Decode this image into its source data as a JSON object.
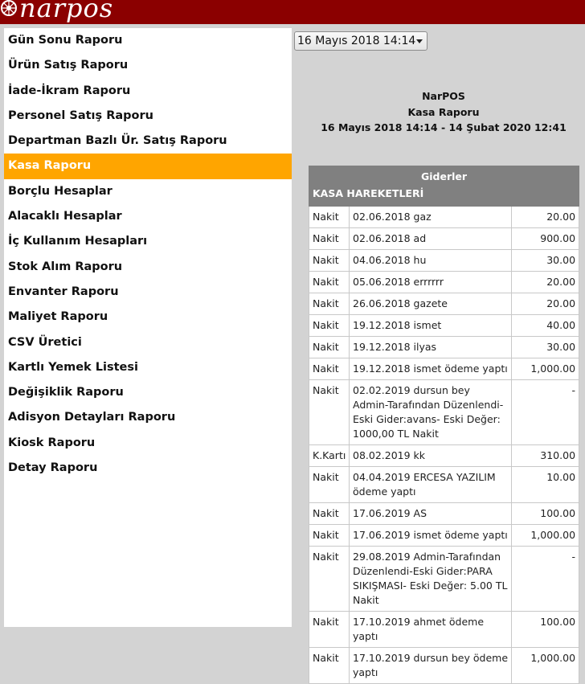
{
  "app": {
    "logo_text": "narpos"
  },
  "sidebar": {
    "items": [
      {
        "label": "Gün Sonu Raporu",
        "active": false
      },
      {
        "label": "Ürün Satış Raporu",
        "active": false
      },
      {
        "label": "İade-İkram Raporu",
        "active": false
      },
      {
        "label": "Personel Satış Raporu",
        "active": false
      },
      {
        "label": "Departman Bazlı Ür. Satış Raporu",
        "active": false
      },
      {
        "label": "Kasa Raporu",
        "active": true
      },
      {
        "label": "Borçlu Hesaplar",
        "active": false
      },
      {
        "label": "Alacaklı Hesaplar",
        "active": false
      },
      {
        "label": "İç Kullanım Hesapları",
        "active": false
      },
      {
        "label": "Stok Alım Raporu",
        "active": false
      },
      {
        "label": "Envanter Raporu",
        "active": false
      },
      {
        "label": "Maliyet Raporu",
        "active": false
      },
      {
        "label": "CSV Üretici",
        "active": false
      },
      {
        "label": "Kartlı Yemek Listesi",
        "active": false
      },
      {
        "label": "Değişiklik Raporu",
        "active": false
      },
      {
        "label": "Adisyon Detayları Raporu",
        "active": false
      },
      {
        "label": "Kiosk Raporu",
        "active": false
      },
      {
        "label": "Detay Raporu",
        "active": false
      }
    ]
  },
  "date_select": {
    "value": "16 Mayıs 2018 14:14"
  },
  "report": {
    "company": "NarPOS",
    "title": "Kasa Raporu",
    "range": "16 Mayıs 2018 14:14 - 14 Şubat 2020 12:41",
    "table_header": "Giderler",
    "section": "KASA HAREKETLERİ",
    "rows": [
      {
        "type": "Nakit",
        "desc": "02.06.2018 gaz",
        "amount": "20.00"
      },
      {
        "type": "Nakit",
        "desc": "02.06.2018 ad",
        "amount": "900.00"
      },
      {
        "type": "Nakit",
        "desc": "04.06.2018 hu",
        "amount": "30.00"
      },
      {
        "type": "Nakit",
        "desc": "05.06.2018 errrrrr",
        "amount": "20.00"
      },
      {
        "type": "Nakit",
        "desc": "26.06.2018 gazete",
        "amount": "20.00"
      },
      {
        "type": "Nakit",
        "desc": "19.12.2018 ismet",
        "amount": "40.00"
      },
      {
        "type": "Nakit",
        "desc": "19.12.2018 ilyas",
        "amount": "30.00"
      },
      {
        "type": "Nakit",
        "desc": "19.12.2018 ismet ödeme yaptı",
        "amount": "1,000.00"
      },
      {
        "type": "Nakit",
        "desc": "02.02.2019 dursun bey Admin-Tarafından Düzenlendi-Eski Gider:avans- Eski Değer: 1000,00 TL Nakit",
        "amount": "-"
      },
      {
        "type": "K.Kartı",
        "desc": "08.02.2019 kk",
        "amount": "310.00"
      },
      {
        "type": "Nakit",
        "desc": "04.04.2019 ERCESA YAZILIM ödeme yaptı",
        "amount": "10.00"
      },
      {
        "type": "Nakit",
        "desc": "17.06.2019 AS",
        "amount": "100.00"
      },
      {
        "type": "Nakit",
        "desc": "17.06.2019 ismet ödeme yaptı",
        "amount": "1,000.00"
      },
      {
        "type": "Nakit",
        "desc": "29.08.2019 Admin-Tarafından Düzenlendi-Eski Gider:PARA SIKIŞMASI- Eski Değer: 5.00 TL Nakit",
        "amount": "-"
      },
      {
        "type": "Nakit",
        "desc": "17.10.2019 ahmet ödeme yaptı",
        "amount": "100.00"
      },
      {
        "type": "Nakit",
        "desc": "17.10.2019 dursun bey ödeme yaptı",
        "amount": "1,000.00"
      }
    ]
  },
  "colors": {
    "topbar": "#8b0000",
    "active": "#ffa500",
    "table_header": "#808080",
    "background": "#d3d3d3"
  }
}
